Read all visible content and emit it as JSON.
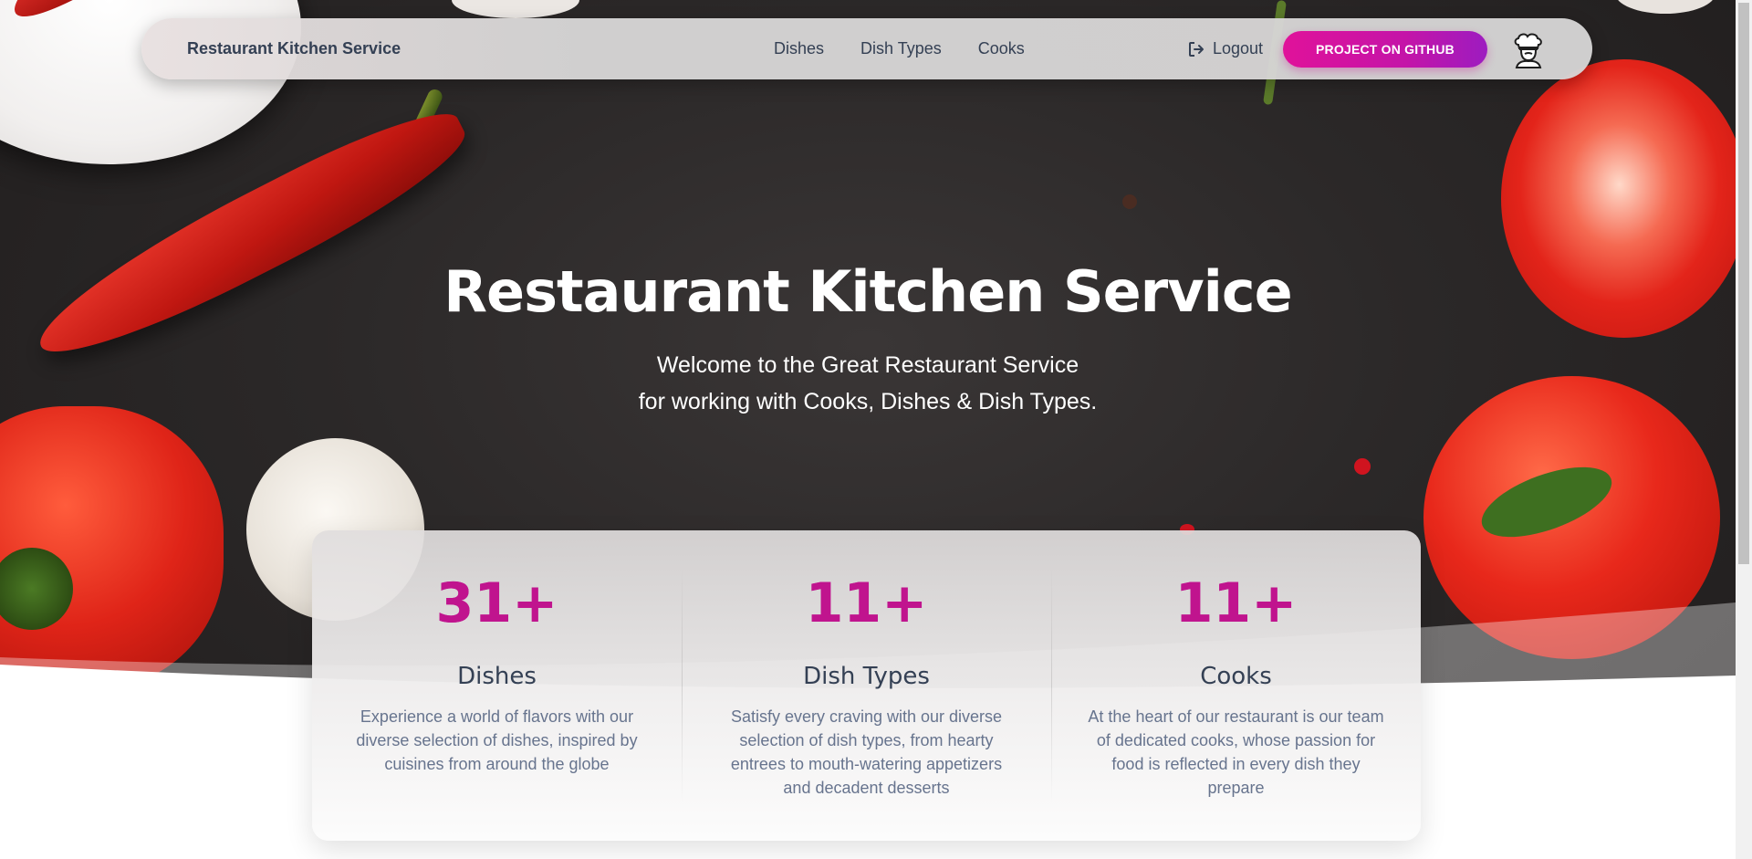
{
  "navbar": {
    "brand": "Restaurant Kitchen Service",
    "links": [
      "Dishes",
      "Dish Types",
      "Cooks"
    ],
    "logout_label": "Logout",
    "github_label": "PROJECT ON GITHUB",
    "avatar_icon": "chef-icon",
    "logout_icon": "sign-out-icon"
  },
  "hero": {
    "title": "Restaurant Kitchen Service",
    "subtitle_line1": "Welcome to the Great Restaurant Service",
    "subtitle_line2": "for working with Cooks, Dishes & Dish Types."
  },
  "stats": [
    {
      "number": "31+",
      "title": "Dishes",
      "description": "Experience a world of flavors with our diverse selection of dishes, inspired by cuisines from around the globe"
    },
    {
      "number": "11+",
      "title": "Dish Types",
      "description": "Satisfy every craving with our diverse selection of dish types, from hearty entrees to mouth-watering appetizers and decadent desserts"
    },
    {
      "number": "11+",
      "title": "Cooks",
      "description": "At the heart of our restaurant is our team of dedicated cooks, whose passion for food is reflected in every dish they prepare"
    }
  ],
  "colors": {
    "accent_gradient_start": "#e0129a",
    "accent_gradient_end": "#9d1cc0",
    "stat_number": "#c0148e",
    "text_dark": "#344054",
    "text_muted": "#67748e"
  }
}
